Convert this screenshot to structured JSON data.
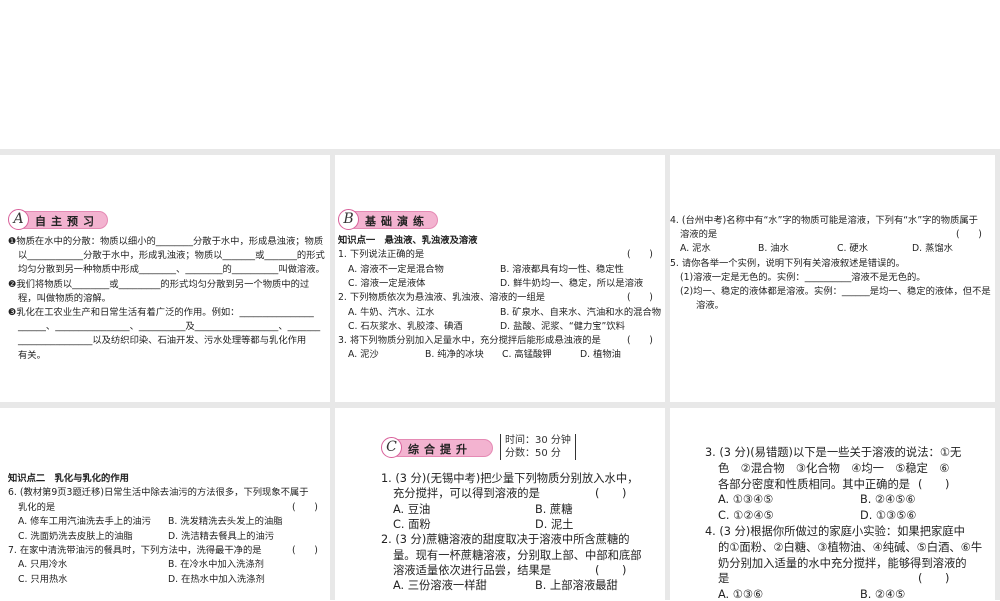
{
  "panels": [
    {
      "id": "a-preview",
      "badge": {
        "letter": "A",
        "title": "自主预习"
      },
      "lines": [
        {
          "k": "q",
          "t": "❶物质在水中的分散：物质以细小的________分散于水中，形成悬浊液；物质"
        },
        {
          "k": "c",
          "t": "以____________分散于水中，形成乳浊液；物质以_______或_______的形式"
        },
        {
          "k": "c",
          "t": "均匀分散到另一种物质中形成________、________的__________叫做溶液。"
        },
        {
          "k": "q",
          "t": "❷我们将物质以________或_________的形式均匀分散到另一个物质中的过"
        },
        {
          "k": "c",
          "t": "程，叫做物质的溶解。"
        },
        {
          "k": "q",
          "t": "❸乳化在工农业生产和日常生活有着广泛的作用。例如：________________"
        },
        {
          "k": "c",
          "t": "______、________________、__________及__________________、_______"
        },
        {
          "k": "c",
          "t": "________________以及纺织印染、石油开发、污水处理等都与乳化作用"
        },
        {
          "k": "c",
          "t": "有关。"
        }
      ]
    },
    {
      "id": "b-basic",
      "badge": {
        "letter": "B",
        "title": "基础演练"
      },
      "lines": [
        {
          "k": "h",
          "t": "知识点一　悬浊液、乳浊液及溶液"
        },
        {
          "k": "q",
          "t": "1. 下列说法正确的是",
          "paren": "(　　)"
        },
        {
          "k": "o2",
          "opts": [
            "A. 溶液不一定是混合物",
            "B. 溶液都具有均一性、稳定性"
          ]
        },
        {
          "k": "o2",
          "opts": [
            "C. 溶液一定是液体",
            "D. 鲜牛奶均一、稳定，所以是溶液"
          ]
        },
        {
          "k": "q",
          "t": "2. 下列物质依次为悬浊液、乳浊液、溶液的一组是",
          "paren": "(　　)"
        },
        {
          "k": "o2",
          "opts": [
            "A. 牛奶、汽水、江水",
            "B. 矿泉水、自来水、汽油和水的混合物"
          ]
        },
        {
          "k": "o2",
          "opts": [
            "C. 石灰浆水、乳胶漆、碘酒",
            "D. 盐酸、泥浆、“健力宝”饮料"
          ]
        },
        {
          "k": "q",
          "t": "3. 将下列物质分别加入足量水中，充分搅拌后能形成悬浊液的是",
          "paren": "(　　)"
        },
        {
          "k": "o4",
          "opts": [
            "A. 泥沙",
            "B. 纯净的冰块",
            "C. 高锰酸钾",
            "D. 植物油"
          ]
        }
      ]
    },
    {
      "id": "b-continued",
      "lines": [
        {
          "k": "q",
          "t": "4. (台州中考)名称中有“水”字的物质可能是溶液，下列有“水”字的物质属于"
        },
        {
          "k": "c",
          "t": "溶液的是",
          "paren": "(　　)"
        },
        {
          "k": "o4",
          "opts": [
            "A. 泥水",
            "B. 油水",
            "C. 硬水",
            "D. 蒸馏水"
          ]
        },
        {
          "k": "q",
          "t": "5. 请你各举一个实例，说明下列有关溶液叙述是错误的。"
        },
        {
          "k": "c",
          "t": "(1)溶液一定是无色的。实例：__________溶液不是无色的。"
        },
        {
          "k": "c",
          "t": "(2)均一、稳定的液体都是溶液。实例：______是均一、稳定的液体，但不是"
        },
        {
          "k": "c2",
          "t": "溶液。"
        }
      ]
    },
    {
      "id": "b-emulsion",
      "lines": [
        {
          "k": "h",
          "t": "知识点二　乳化与乳化的作用"
        },
        {
          "k": "q",
          "t": "6. (教材第9页3题迁移)日常生活中除去油污的方法很多，下列现象不属于"
        },
        {
          "k": "c",
          "t": "乳化的是",
          "paren": "(　　)"
        },
        {
          "k": "o2",
          "opts": [
            "A. 修车工用汽油洗去手上的油污",
            "B. 洗发精洗去头发上的油脂"
          ]
        },
        {
          "k": "o2",
          "opts": [
            "C. 洗面奶洗去皮肤上的油脂",
            "D. 洗洁精去餐具上的油污"
          ]
        },
        {
          "k": "q",
          "t": "7. 在家中清洗带油污的餐具时，下列方法中，洗得最干净的是",
          "paren": "(　　)"
        },
        {
          "k": "o2",
          "opts": [
            "A. 只用冷水",
            "B. 在冷水中加入洗涤剂"
          ]
        },
        {
          "k": "o2",
          "opts": [
            "C. 只用热水",
            "D. 在热水中加入洗涤剂"
          ]
        }
      ]
    },
    {
      "id": "c-comprehensive",
      "badge": {
        "letter": "C",
        "title": "综合提升"
      },
      "timebox": {
        "time": "时间：30 分钟",
        "score": "分数：50 分"
      },
      "lines": [
        {
          "k": "q",
          "t": "1. (3 分)(无锡中考)把少量下列物质分别放入水中，"
        },
        {
          "k": "c",
          "t": "充分搅拌，可以得到溶液的是",
          "paren": "(　　)"
        },
        {
          "k": "o2",
          "opts": [
            "A. 豆油",
            "B. 蔗糖"
          ]
        },
        {
          "k": "o2",
          "opts": [
            "C. 面粉",
            "D. 泥土"
          ]
        },
        {
          "k": "q",
          "t": "2. (3 分)蔗糖溶液的甜度取决于溶液中所含蔗糖的"
        },
        {
          "k": "c",
          "t": "量。现有一杯蔗糖溶液，分别取上部、中部和底部"
        },
        {
          "k": "c",
          "t": "溶液适量依次进行品尝，结果是",
          "paren": "(　　)"
        },
        {
          "k": "o2",
          "opts": [
            "A. 三份溶液一样甜",
            "B. 上部溶液最甜"
          ]
        }
      ]
    },
    {
      "id": "c-continued",
      "lines": [
        {
          "k": "q",
          "t": "3. (3 分)(易错题)以下是一些关于溶液的说法：①无"
        },
        {
          "k": "c",
          "t": "色　②混合物　③化合物　④均一　⑤稳定　⑥"
        },
        {
          "k": "c",
          "t": "各部分密度和性质相同。其中正确的是",
          "paren": "(　　)"
        },
        {
          "k": "o2",
          "opts": [
            "A. ①③④⑤",
            "B. ②④⑤⑥"
          ]
        },
        {
          "k": "o2",
          "opts": [
            "C. ①②④⑤",
            "D. ①③⑤⑥"
          ]
        },
        {
          "k": "q",
          "t": "4. (3 分)根据你所做过的家庭小实验：如果把家庭中"
        },
        {
          "k": "c",
          "t": "的①面粉、②白糖、③植物油、④纯碱、⑤白酒、⑥牛"
        },
        {
          "k": "c",
          "t": "奶分别加入适量的水中充分搅拌，能够得到溶液的"
        },
        {
          "k": "c",
          "t": "是",
          "paren": "(　　)"
        },
        {
          "k": "o2",
          "opts": [
            "A. ①③⑥",
            "B. ②④⑤"
          ]
        }
      ]
    }
  ],
  "colors": {
    "badge": "#f3b3d0",
    "badge_border": "#d8609a",
    "gutter": "#e8e8e8"
  }
}
